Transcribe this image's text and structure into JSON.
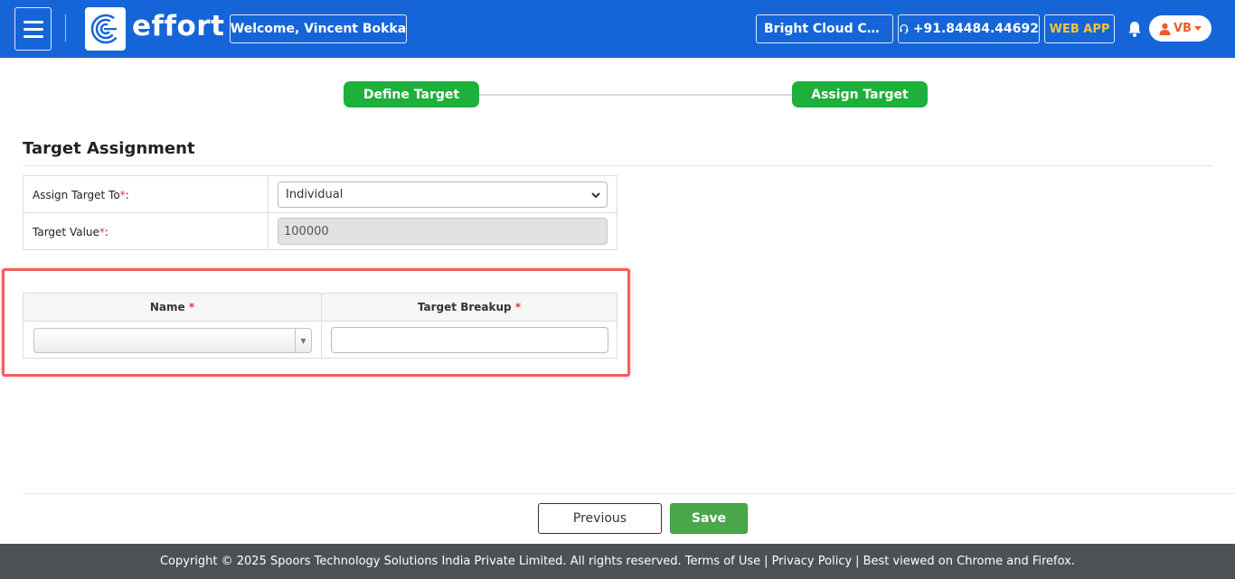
{
  "header": {
    "logo_text": "effort",
    "welcome": "Welcome, Vincent Bokka",
    "company": "Bright Cloud Corporation",
    "phone": "+91.84484.44692",
    "web_app": "WEB APP",
    "avatar_initials": "VB",
    "brand_color": "#1565d8"
  },
  "stepper": {
    "steps": [
      {
        "label": "Define Target"
      },
      {
        "label": "Assign Target"
      }
    ],
    "step_color": "#1db03a"
  },
  "section": {
    "title": "Target Assignment"
  },
  "form": {
    "assign_to_label": "Assign Target To",
    "assign_to_value": "Individual",
    "target_value_label": "Target Value",
    "target_value": "100000",
    "required_mark": "*",
    "label_suffix": " :"
  },
  "assignment_grid": {
    "columns": [
      {
        "label": "Name"
      },
      {
        "label": "Target Breakup"
      }
    ],
    "row": {
      "name_value": "",
      "target_breakup_value": ""
    },
    "highlight_color": "#f0605a"
  },
  "actions": {
    "previous_label": "Previous",
    "save_label": "Save"
  },
  "footer": {
    "copyright": "Copyright © 2025 Spoors Technology Solutions India Private Limited. All rights reserved.",
    "terms": "Terms of Use",
    "privacy": "Privacy Policy",
    "best_viewed": "Best viewed on Chrome and Firefox."
  }
}
